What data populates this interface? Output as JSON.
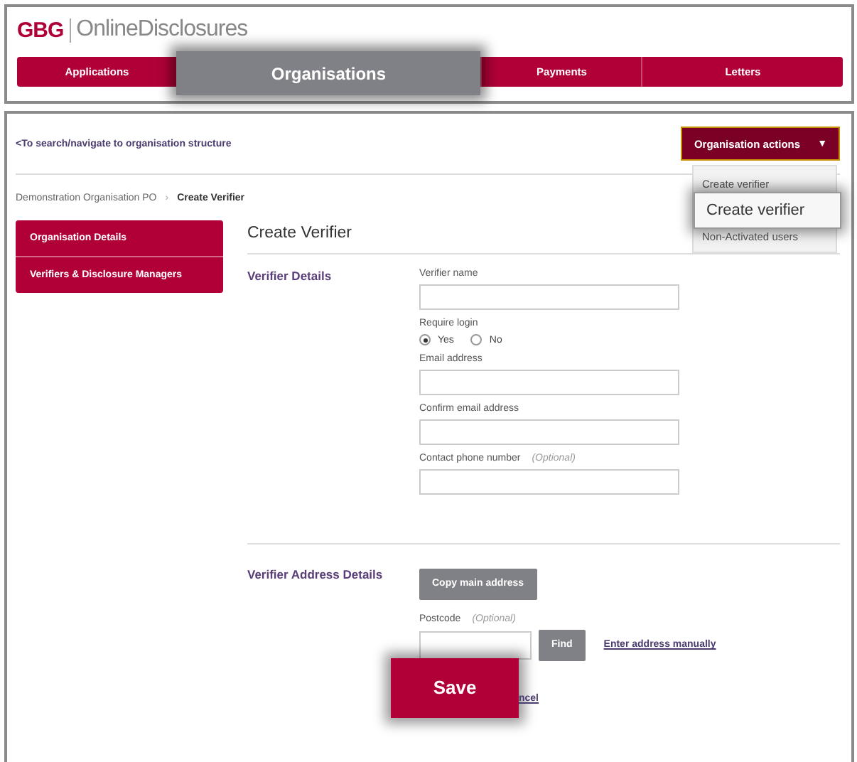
{
  "header": {
    "logo_brand": "GBG",
    "logo_product": "OnlineDisclosures"
  },
  "nav_tabs": [
    {
      "label": "Applications",
      "selected": false
    },
    {
      "label": "Organisations",
      "selected": true
    },
    {
      "label": "Payments",
      "selected": false
    },
    {
      "label": "Letters",
      "selected": false
    }
  ],
  "back_link": "<To search/navigate to organisation structure",
  "actions_button": {
    "label": "Organisation actions",
    "caret": "▼",
    "expanded": true
  },
  "actions_menu": {
    "items": [
      "Create verifier",
      "Non-Activated users"
    ],
    "callout": "Create verifier"
  },
  "breadcrumb": {
    "parent": "Demonstration Organisation PO",
    "separator": "›",
    "current": "Create Verifier"
  },
  "sidebar": {
    "items": [
      {
        "label": "Organisation Details"
      },
      {
        "label": "Verifiers & Disclosure Managers"
      }
    ]
  },
  "page_title": "Create Verifier",
  "verifier_details": {
    "heading": "Verifier Details",
    "fields": [
      {
        "kind": "text",
        "label": "Verifier name"
      },
      {
        "kind": "radio",
        "label": "Require login",
        "options": [
          {
            "label": "Yes",
            "selected": true
          },
          {
            "label": "No",
            "selected": false
          }
        ]
      },
      {
        "kind": "text",
        "label": "Email address"
      },
      {
        "kind": "text",
        "label": "Confirm email address"
      },
      {
        "kind": "text",
        "label": "Contact phone number",
        "note": "(Optional)"
      }
    ]
  },
  "address_details": {
    "heading": "Verifier Address Details",
    "copy_button": "Copy main address",
    "postcode_label": "Postcode",
    "postcode_note": "(Optional)",
    "find_button": "Find",
    "manual_link": "Enter address manually"
  },
  "save_button": "Save",
  "cancel_link": "ncel"
}
